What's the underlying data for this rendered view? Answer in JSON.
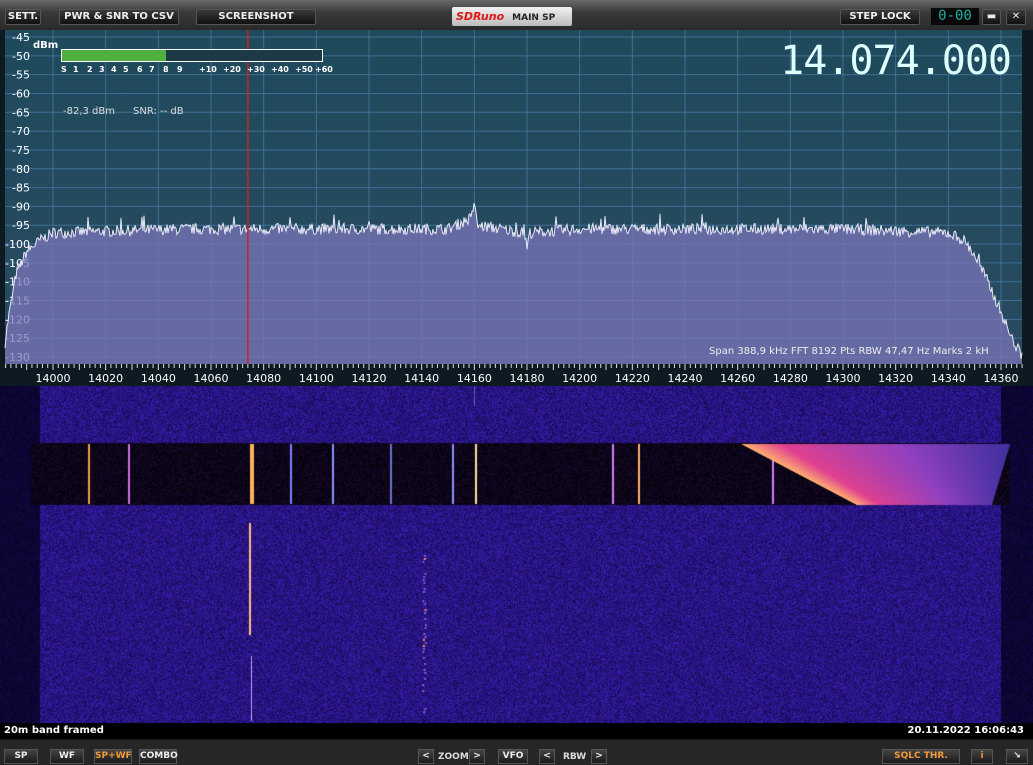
{
  "toolbar": {
    "settings": "SETT.",
    "pwr_csv": "PWR & SNR TO CSV",
    "screenshot": "SCREENSHOT",
    "app_logo": "SDRuno",
    "window_title": "MAIN SP",
    "step_lock": "STEP LOCK",
    "step_display": "0-00",
    "minimize": "▬",
    "close": "✕"
  },
  "spectrum": {
    "frequency_display": "14.074.000",
    "dbm_unit": "dBm",
    "smeter_labels": [
      "S",
      "1",
      "2",
      "3",
      "4",
      "5",
      "6",
      "7",
      "8",
      "9",
      "+10",
      "+20",
      "+30",
      "+40",
      "+50",
      "+60"
    ],
    "smeter_level_fraction": 0.4,
    "power_readout": "-82,3 dBm",
    "snr_readout": "SNR: -- dB",
    "info": "Span 388,9 kHz  FFT 8192 Pts  RBW 47,47 Hz  Marks 2 kH",
    "vfo_marker_khz": 14074,
    "colors": {
      "background": "#1f4a5a",
      "trace_fill": "#7a76b8",
      "vfo_line": "#d02020",
      "smeter_fill": "#4fb040"
    }
  },
  "chart_data": {
    "type": "area",
    "xlabel": "",
    "ylabel": "dBm",
    "xlim": [
      13981,
      14369
    ],
    "ylim": [
      -132,
      -43
    ],
    "x_ticks": [
      14000,
      14020,
      14040,
      14060,
      14080,
      14100,
      14120,
      14140,
      14160,
      14180,
      14200,
      14220,
      14240,
      14260,
      14280,
      14300,
      14320,
      14340,
      14360
    ],
    "y_ticks": [
      -45,
      -50,
      -55,
      -60,
      -65,
      -70,
      -75,
      -80,
      -85,
      -90,
      -95,
      -100,
      -105,
      -110,
      -115,
      -120,
      -125,
      -130
    ],
    "grid": true,
    "x": [
      13981,
      13983,
      13986,
      13990,
      13995,
      14000,
      14050,
      14100,
      14150,
      14159,
      14160,
      14161,
      14170,
      14179,
      14180,
      14181,
      14200,
      14250,
      14300,
      14340,
      14346,
      14350,
      14355,
      14360,
      14364,
      14369
    ],
    "y": [
      -130,
      -120,
      -108,
      -102,
      -99,
      -97,
      -96,
      -96,
      -96,
      -93,
      -88,
      -95,
      -96,
      -97,
      -101,
      -97,
      -96,
      -96,
      -96,
      -97,
      -99,
      -103,
      -110,
      -118,
      -125,
      -131
    ]
  },
  "status": {
    "left": "20m band framed",
    "right": "20.11.2022 16:06:43"
  },
  "bottom": {
    "sp": "SP",
    "wf": "WF",
    "spwf": "SP+WF",
    "combo": "COMBO",
    "zoom_prev": "<",
    "zoom": "ZOOM",
    "zoom_next": ">",
    "vfo": "VFO",
    "rbw_prev": "<",
    "rbw": "RBW",
    "rbw_next": ">",
    "sqlc": "SQLC THR.",
    "info": "i",
    "resize": "↘"
  }
}
